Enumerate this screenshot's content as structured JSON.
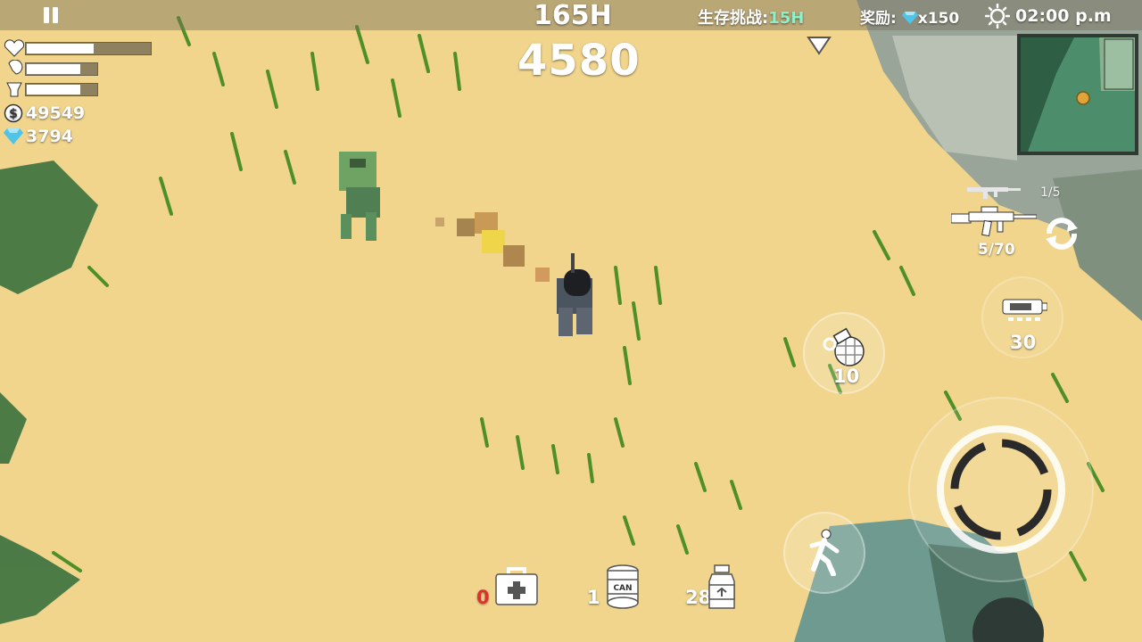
{
  "hud": {
    "survival_hours": "165H",
    "score": "4580",
    "challenge_label": "生存挑战:",
    "challenge_value": "15H",
    "reward_label": "奖励:",
    "reward_value": "x150",
    "time": "02:00 p.m"
  },
  "stats": {
    "health": 0.55,
    "hunger": 0.78,
    "thirst": 0.78
  },
  "currency": {
    "coins": "49549",
    "gems": "3794"
  },
  "weapons": {
    "secondary_ammo": "1/5",
    "primary_ammo": "5/70",
    "ammo_box_count": "30",
    "grenade_count": "10"
  },
  "inventory": {
    "medkit_count": "0",
    "can_count": "1",
    "can_label": "CAN",
    "pills_count": "28"
  },
  "colors": {
    "sand": "#f1d58c",
    "grass": "#5a9a2c",
    "medkit_zero": "#d9332e",
    "challenge_accent": "#8ef0c8",
    "gem": "#4fc3e8"
  }
}
